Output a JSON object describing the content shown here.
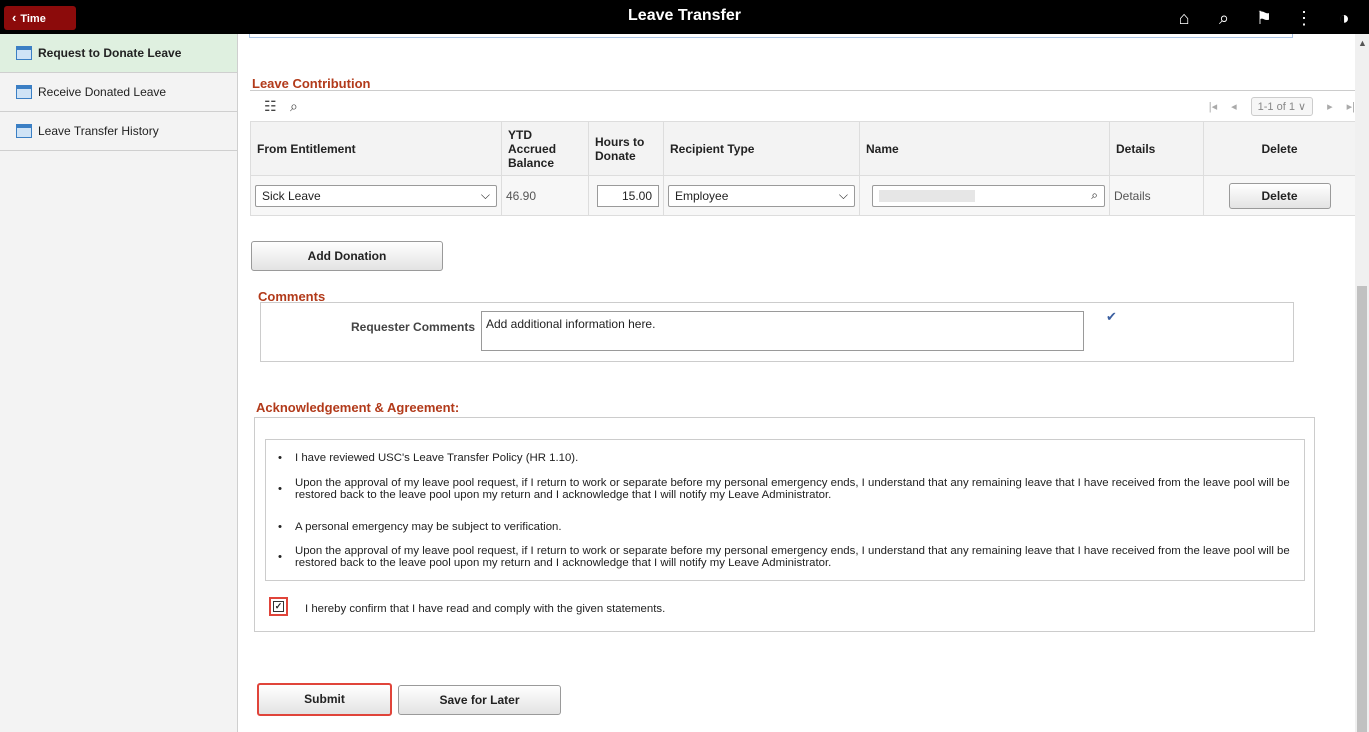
{
  "header": {
    "back_label": "Time",
    "title": "Leave Transfer",
    "icons": [
      "home-icon",
      "search-icon",
      "flag-icon",
      "more-icon",
      "navbar-icon"
    ]
  },
  "sidebar": {
    "items": [
      {
        "label": "Request to Donate Leave",
        "active": true
      },
      {
        "label": "Receive Donated Leave",
        "active": false
      },
      {
        "label": "Leave Transfer History",
        "active": false
      }
    ]
  },
  "contribution": {
    "title": "Leave Contribution",
    "pager": "1-1 of 1",
    "columns": {
      "from": "From Entitlement",
      "ytd": "YTD Accrued Balance",
      "hours": "Hours to Donate",
      "recipient": "Recipient Type",
      "name": "Name",
      "details": "Details",
      "delete": "Delete"
    },
    "row": {
      "from": "Sick Leave",
      "ytd": "46.90",
      "hours": "15.00",
      "recipient": "Employee",
      "name": "",
      "details": "Details",
      "delete": "Delete"
    },
    "add_button": "Add Donation"
  },
  "comments": {
    "title": "Comments",
    "label": "Requester Comments",
    "value": "Add additional information here."
  },
  "ack": {
    "title": "Acknowledgement & Agreement:",
    "items": [
      "I have reviewed USC's Leave Transfer Policy (HR 1.10).",
      "Upon the approval of my leave pool request, if I return to work or separate before my personal emergency ends, I understand that any remaining leave that I have received from the leave pool will be restored back to the leave pool upon my return and I acknowledge that I will notify my Leave Administrator.",
      "A personal emergency may be subject to verification.",
      "Upon the approval of my leave pool request, if I return to work or separate before my personal emergency ends, I understand that any remaining leave that I have received from the leave pool will be restored back to the leave pool upon my return and I acknowledge that I will notify my Leave Administrator."
    ],
    "confirm_checked": true,
    "confirm_text": "I hereby confirm that I have read and comply with the given statements."
  },
  "actions": {
    "submit": "Submit",
    "save_later": "Save for Later"
  },
  "colors": {
    "header_bg": "#000000",
    "back_button": "#8c0b0b",
    "section_title": "#b23a1a",
    "active_item": "#dff0e0",
    "highlight": "#e0443a"
  }
}
